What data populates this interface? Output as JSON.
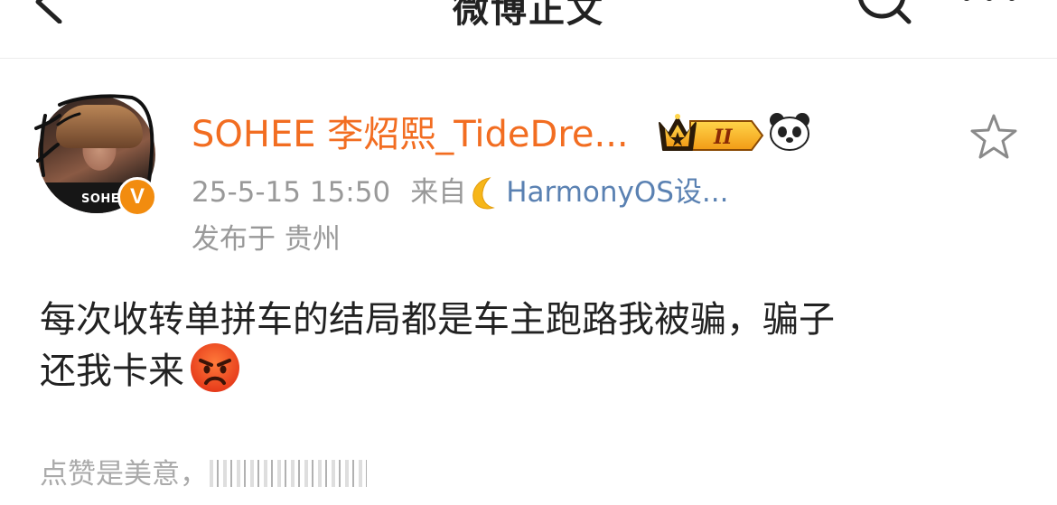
{
  "nav": {
    "title": "微博正文",
    "back_icon": "chevron-left-icon",
    "search_icon": "search-icon",
    "more_icon": "more-dots-icon"
  },
  "post": {
    "author": {
      "name": "SOHEE 李炤熙_TideDre...",
      "avatar_text": "SOHEE",
      "verified_mark": "V",
      "name_color": "#f26d21",
      "badges": [
        "crown-level-badge",
        "panda-badge"
      ],
      "crown_level": "II"
    },
    "timestamp": "25-5-15 15:50",
    "source_prefix": "来自",
    "source_name": "HarmonyOS设...",
    "location": "发布于 贵州",
    "body_lines": [
      "每次收转单拼车的结局都是车主跑路我被骗，骗子",
      "还我卡来"
    ],
    "favorite_icon": "star-outline-icon",
    "emoji": "angry-face-emoji"
  },
  "footer": {
    "text": "点赞是美意，"
  },
  "colors": {
    "accent_orange": "#f26d21",
    "link_blue": "#5a81b2",
    "meta_gray": "#999999",
    "badge_orange": "#f28c0f"
  }
}
